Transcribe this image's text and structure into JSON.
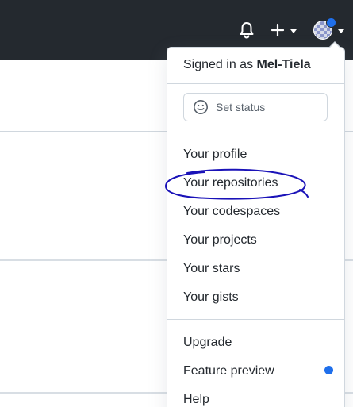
{
  "header": {
    "notifications_icon": "bell-icon",
    "create_icon": "plus-icon",
    "avatar_icon": "avatar-icon"
  },
  "dropdown": {
    "signed_in_prefix": "Signed in as",
    "username": "Mel-Tiela",
    "status_button_label": "Set status",
    "primary_items": [
      {
        "label": "Your profile"
      },
      {
        "label": "Your repositories"
      },
      {
        "label": "Your codespaces"
      },
      {
        "label": "Your projects"
      },
      {
        "label": "Your stars"
      },
      {
        "label": "Your gists"
      }
    ],
    "secondary_items": [
      {
        "label": "Upgrade"
      },
      {
        "label": "Feature preview"
      },
      {
        "label": "Help"
      }
    ]
  },
  "colors": {
    "header_bg": "#24292f",
    "accent_blue": "#1f6feb",
    "annotation_ink": "#1a12b8",
    "text_primary": "#24292f",
    "border": "#d0d7de"
  }
}
